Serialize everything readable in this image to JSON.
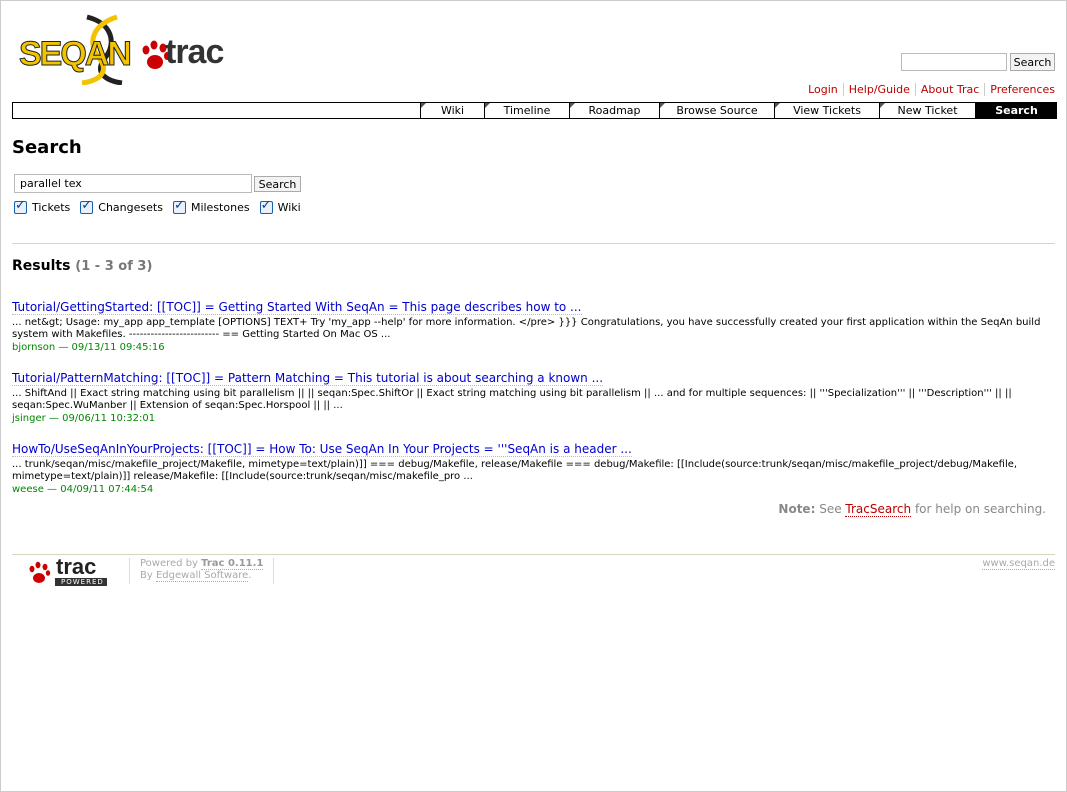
{
  "logo": {
    "seq_text": "SEQAN",
    "trac_text": "trac"
  },
  "top_search": {
    "value": "",
    "button": "Search"
  },
  "metanav": [
    "Login",
    "Help/Guide",
    "About Trac",
    "Preferences"
  ],
  "mainnav": [
    {
      "label": "Wiki"
    },
    {
      "label": "Timeline"
    },
    {
      "label": "Roadmap"
    },
    {
      "label": "Browse Source"
    },
    {
      "label": "View Tickets"
    },
    {
      "label": "New Ticket"
    },
    {
      "label": "Search",
      "active": true
    }
  ],
  "page": {
    "title": "Search"
  },
  "query": {
    "value": "parallel tex",
    "button": "Search"
  },
  "filters": [
    {
      "label": "Tickets",
      "checked": true
    },
    {
      "label": "Changesets",
      "checked": true
    },
    {
      "label": "Milestones",
      "checked": true
    },
    {
      "label": "Wiki",
      "checked": true
    }
  ],
  "results": {
    "heading": "Results",
    "count": "(1 - 3 of 3)",
    "items": [
      {
        "title": "Tutorial/GettingStarted: [[TOC]] = Getting Started With SeqAn = This page describes how to ...",
        "excerpt": "... net&gt; Usage: my_app app_template [OPTIONS] TEXT+ Try 'my_app --help' for more information. </pre> }}} Congratulations, you have successfully created your first application within the SeqAn build system with Makefiles. ------------------------- == Getting Started On Mac OS ...",
        "author": "bjornson",
        "date": "09/13/11 09:45:16"
      },
      {
        "title": "Tutorial/PatternMatching: [[TOC]] = Pattern Matching = This tutorial is about searching a known ...",
        "excerpt": "... ShiftAnd || Exact string matching using bit parallelism || || seqan:Spec.ShiftOr || Exact string matching using bit parallelism || ... and for multiple sequences: || '''Specialization''' || '''Description''' || || seqan:Spec.WuManber || Extension of seqan:Spec.Horspool || || ...",
        "author": "jsinger",
        "date": "09/06/11 10:32:01"
      },
      {
        "title": "HowTo/UseSeqAnInYourProjects: [[TOC]] = How To: Use SeqAn In Your Projects = '''SeqAn is a header ...",
        "excerpt": "... trunk/seqan/misc/makefile_project/Makefile, mimetype=text/plain)]] === debug/Makefile, release/Makefile === debug/Makefile: [[Include(source:trunk/seqan/misc/makefile_project/debug/Makefile, mimetype=text/plain)]] release/Makefile: [[Include(source:trunk/seqan/misc/makefile_pro ...",
        "author": "weese",
        "date": "04/09/11 07:44:54"
      }
    ]
  },
  "note": {
    "label": "Note:",
    "pre": "See",
    "link": "TracSearch",
    "post": "for help on searching."
  },
  "footer": {
    "powered_by": "Powered by",
    "trac_version": "Trac 0.11.1",
    "by": "By",
    "company": "Edgewall Software",
    "site": "www.seqan.de",
    "trac_logo_text": "trac",
    "trac_logo_sub": "POWERED"
  },
  "colors": {
    "link": "#0000cc",
    "meta_link": "#bb0000",
    "meta_green": "#008800",
    "logo_yellow": "#f2c300"
  }
}
